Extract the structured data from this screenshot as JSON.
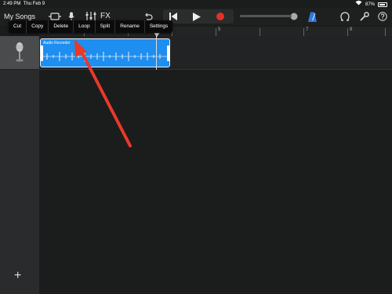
{
  "status_bar": {
    "time": "2:49 PM",
    "date": "Thu Feb 9",
    "battery": "87%"
  },
  "toolbar": {
    "back_label": "My Songs",
    "fx_label": "FX"
  },
  "edit_menu": {
    "items": [
      "Cut",
      "Copy",
      "Delete",
      "Loop",
      "Split",
      "Rename",
      "Settings"
    ]
  },
  "ruler": {
    "numbers": [
      "5",
      "7",
      "8"
    ]
  },
  "region": {
    "title": "Audio Recorder"
  },
  "annotation_color": "#e8392b",
  "icons": {
    "wifi": "wifi-icon",
    "tracks_view": "tracks-view-icon",
    "mic": "microphone-icon",
    "mixer": "mixer-icon",
    "undo": "undo-icon",
    "rewind": "rewind-icon",
    "play": "play-icon",
    "record": "record-icon",
    "metronome": "metronome-icon",
    "loops": "loop-browser-icon",
    "settings": "wrench-icon",
    "help": "help-icon",
    "add": "add-icon"
  }
}
